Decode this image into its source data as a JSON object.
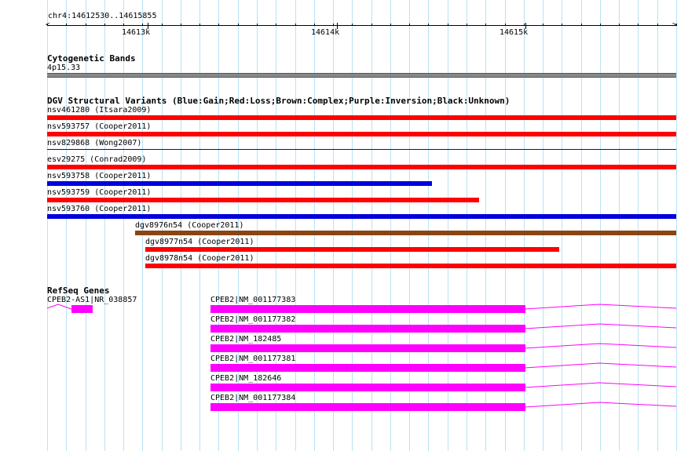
{
  "ruler": {
    "position_label": "chr4:14612530..14615855",
    "tick_labels": [
      "14613k",
      "14614k",
      "14615k"
    ]
  },
  "colors": {
    "gain": "#0000dd",
    "loss": "#ff0000",
    "complex": "#8b4513",
    "unknown": "#000000",
    "refseq": "#ff00ff",
    "cytoband": "#888888",
    "gridline": "#b9e3f5"
  },
  "cytobands": {
    "title": "Cytogenetic Bands",
    "band": "4p15.33"
  },
  "dgv": {
    "title": "DGV Structural Variants (Blue:Gain;Red:Loss;Brown:Complex;Purple:Inversion;Black:Unknown)",
    "features": [
      {
        "label": "nsv461280 (Itsara2009)",
        "type": "loss"
      },
      {
        "label": "nsv593757 (Cooper2011)",
        "type": "loss"
      },
      {
        "label": "nsv829868 (Wong2007)",
        "type": "gain"
      },
      {
        "label": "esv29275 (Conrad2009)",
        "type": "loss"
      },
      {
        "label": "nsv593758 (Cooper2011)",
        "type": "gain"
      },
      {
        "label": "nsv593759 (Cooper2011)",
        "type": "loss"
      },
      {
        "label": "nsv593760 (Cooper2011)",
        "type": "gain"
      },
      {
        "label": "dgv8976n54 (Cooper2011)",
        "type": "complex"
      },
      {
        "label": "dgv8977n54 (Cooper2011)",
        "type": "loss"
      },
      {
        "label": "dgv8978n54 (Cooper2011)",
        "type": "loss"
      }
    ]
  },
  "refseq": {
    "title": "RefSeq Genes",
    "features": [
      {
        "label": "CPEB2-AS1|NR_038857"
      },
      {
        "label": "CPEB2|NM_001177383"
      },
      {
        "label": "CPEB2|NM_001177382"
      },
      {
        "label": "CPEB2|NM_182485"
      },
      {
        "label": "CPEB2|NM_001177381"
      },
      {
        "label": "CPEB2|NM_182646"
      },
      {
        "label": "CPEB2|NM_001177384"
      }
    ]
  }
}
